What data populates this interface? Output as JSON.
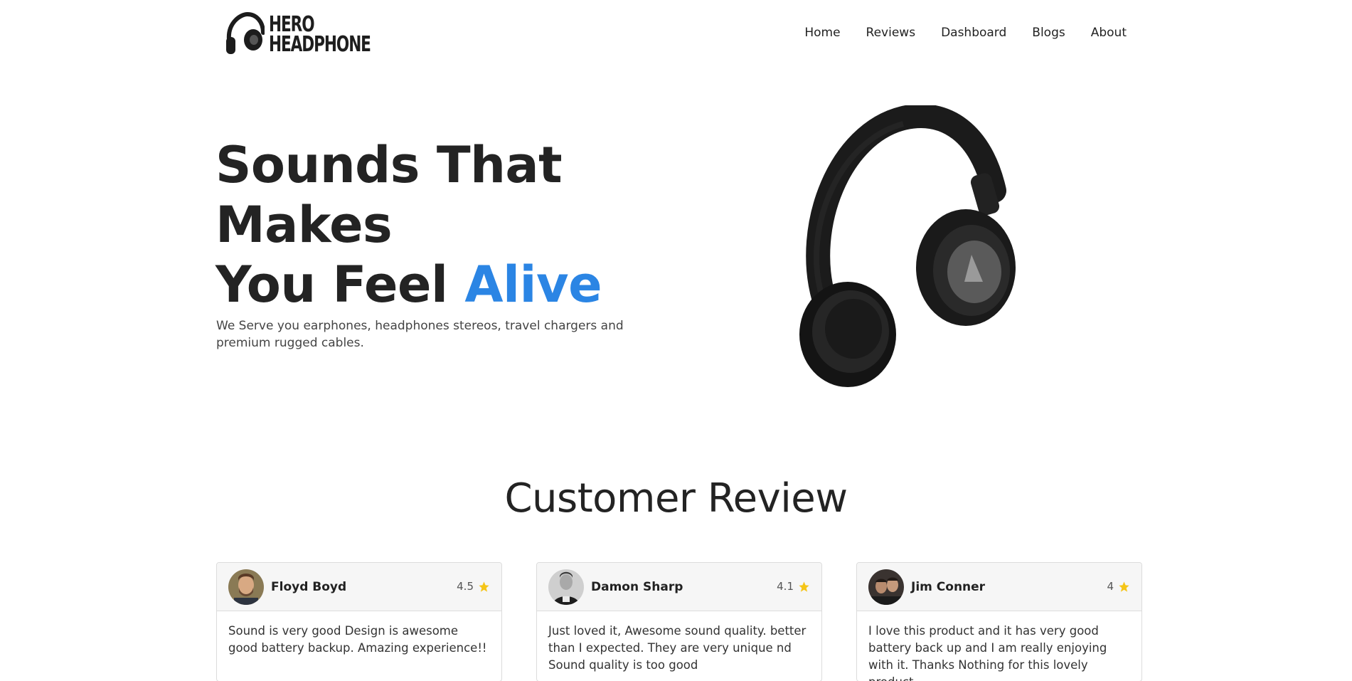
{
  "brand": {
    "line1": "HERO",
    "line2": "HEADPHONE"
  },
  "nav": {
    "items": [
      "Home",
      "Reviews",
      "Dashboard",
      "Blogs",
      "About"
    ]
  },
  "hero": {
    "title_line1": "Sounds That",
    "title_line2": "Makes",
    "title_line3_prefix": "You Feel",
    "title_line3_accent": "Alive",
    "subtitle": "We Serve you earphones, headphones stereos, travel chargers and premium rugged cables.",
    "accent_color": "#2b85e4"
  },
  "reviews": {
    "section_title": "Customer Review",
    "items": [
      {
        "name": "Floyd Boyd",
        "rating": "4.5",
        "text": "Sound is very good Design is awesome good battery backup. Amazing experience!!"
      },
      {
        "name": "Damon Sharp",
        "rating": "4.1",
        "text": "Just loved it, Awesome sound quality. better than I expected. They are very unique nd Sound quality is too good"
      },
      {
        "name": "Jim Conner",
        "rating": "4",
        "text": "I love this product and it has very good battery back up and I am really enjoying with it. Thanks Nothing for this lovely product"
      }
    ],
    "star_color": "#f5c518",
    "star_icon": "star-icon"
  }
}
